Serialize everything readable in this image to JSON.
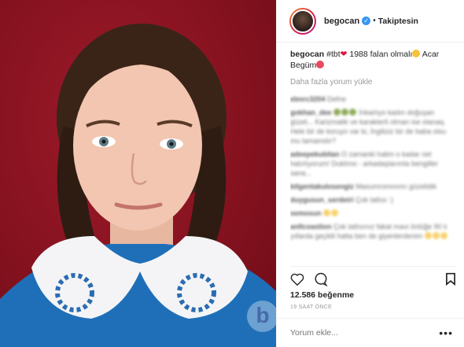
{
  "post": {
    "username": "begocan",
    "follow_state": "Takiptesin",
    "separator": "•"
  },
  "caption": {
    "username": "begocan",
    "hashtag": "#tbt",
    "text1": "1988 falan olmalı",
    "text2": "Acar",
    "text3": "Begüm"
  },
  "load_more": "Daha fazla yorum yükle",
  "blurred_comments": [
    {
      "user": "ebnrc3204",
      "text": "Defne"
    },
    {
      "user": "gokhan_dee",
      "text": "İnkarlıyo kadın doğuşan güzel... Karizmatik ve karakterli olman ise olanaq. Hele bir de koruyo var ki, İngiliziz bir de baba olsu mu tamamdır?"
    },
    {
      "user": "adeepekubilan",
      "text": "O zamanki halim o kadar net hatırlıyorum! Duklmsi - arkadaşlarımla bengiller sana..."
    },
    {
      "user": "bilgentakulosengiz",
      "text": "Masumromnnnn güzelidik"
    },
    {
      "user": "duygusun_serdeiri",
      "text": "Çok tatlısı :)"
    },
    {
      "user": "semosun",
      "text": ""
    },
    {
      "user": "anllcoastion",
      "text": "Çok tatlısınız fakat mavi önlüğe 90 lı yıllarda geçildi hatta ben de giyenlerdenim"
    }
  ],
  "likes": "12.586 beğenme",
  "time_ago": "19 SAAT ÖNCE",
  "comment_input": {
    "placeholder": "Yorum ekle..."
  },
  "more_label": "•••",
  "watermark": "b"
}
